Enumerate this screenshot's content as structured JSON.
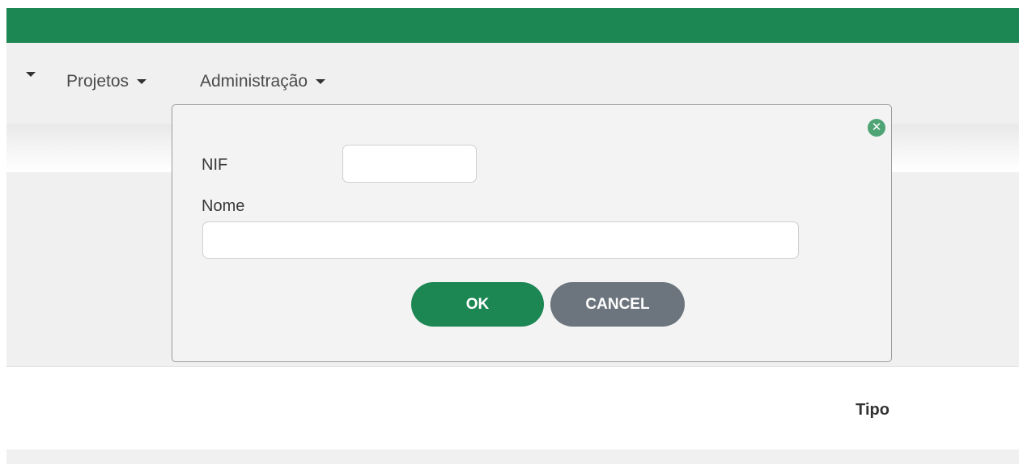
{
  "navbar": {
    "items": [
      {
        "label": ""
      },
      {
        "label": "Projetos"
      },
      {
        "label": "Administração"
      }
    ]
  },
  "table": {
    "column_tipo": "Tipo"
  },
  "modal": {
    "nif_label": "NIF",
    "nif_value": "",
    "nome_label": "Nome",
    "nome_value": "",
    "ok_label": "OK",
    "cancel_label": "CANCEL",
    "close_icon": "close-circle-icon"
  },
  "colors": {
    "primary_green": "#1d8754",
    "secondary_gray": "#6c757d",
    "close_icon_green": "#4fa475"
  }
}
